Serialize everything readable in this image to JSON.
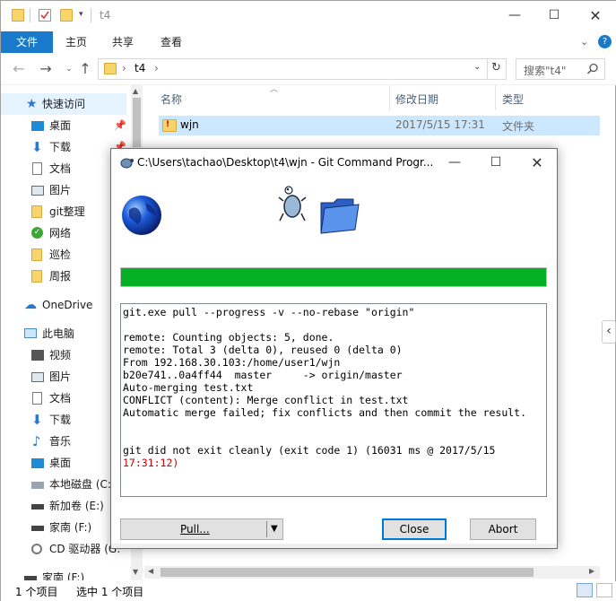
{
  "explorer": {
    "title": "t4",
    "ribbon_tabs": [
      "文件",
      "主页",
      "共享",
      "查看"
    ],
    "address": {
      "folder": "t4"
    },
    "search": {
      "placeholder": "搜索\"t4\""
    },
    "nav": {
      "quick_access": "快速访问",
      "quick_items": [
        "桌面",
        "下载",
        "文档",
        "图片",
        "git整理",
        "网络",
        "巡检",
        "周报"
      ],
      "onedrive": "OneDrive",
      "this_pc": "此电脑",
      "pc_items": [
        "视频",
        "图片",
        "文档",
        "下载",
        "音乐",
        "桌面",
        "本地磁盘 (C:",
        "新加卷 (E:)",
        "家南 (F:)",
        "CD 驱动器 (G:",
        "家南 (F:)"
      ]
    },
    "columns": [
      "名称",
      "修改日期",
      "类型"
    ],
    "files": [
      {
        "name": "wjn",
        "modified": "2017/5/15 17:31",
        "type": "文件夹"
      }
    ],
    "status": {
      "items": "1 个项目",
      "selected": "选中 1 个项目"
    }
  },
  "dialog": {
    "title": "C:\\Users\\tachao\\Desktop\\t4\\wjn - Git Command Progr...",
    "progress_fraction": 1.0,
    "log_lines": [
      "git.exe pull --progress -v --no-rebase \"origin\"",
      "",
      "remote: Counting objects: 5, done.",
      "remote: Total 3 (delta 0), reused 0 (delta 0)",
      "From 192.168.30.103:/home/user1/wjn",
      "b20e741..0a4ff44  master     -> origin/master",
      "Auto-merging test.txt",
      "CONFLICT (content): Merge conflict in test.txt",
      "Automatic merge failed; fix conflicts and then commit the result.",
      "",
      "",
      "git did not exit cleanly (exit code 1) (16031 ms @ 2017/5/15"
    ],
    "log_time_red": "17:31:12)",
    "buttons": {
      "pull": "Pull...",
      "close": "Close",
      "abort": "Abort"
    },
    "colors": {
      "progress": "#06b025",
      "error": "#c00000",
      "accent": "#0078d7"
    }
  }
}
